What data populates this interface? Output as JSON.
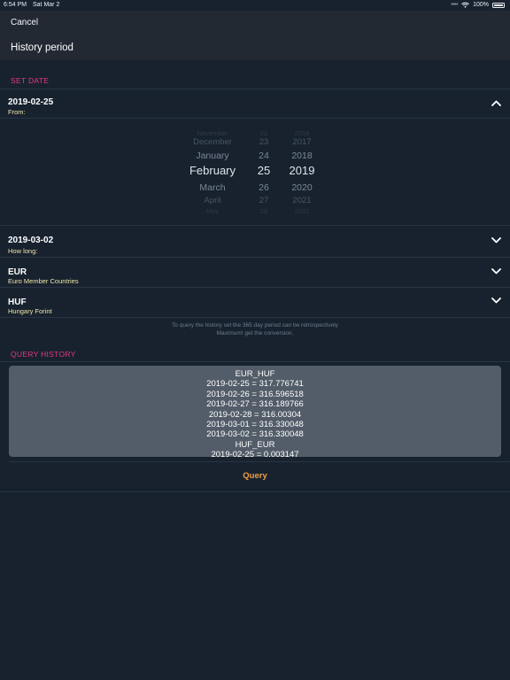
{
  "status_bar": {
    "time": "6:54 PM",
    "date": "Sat Mar 2",
    "battery": "100%"
  },
  "nav": {
    "cancel_label": "Cancel",
    "title": "History period"
  },
  "sections": {
    "set_date": "SET DATE",
    "query_history": "QUERY HISTORY"
  },
  "from_row": {
    "value": "2019-02-25",
    "label": "From:"
  },
  "date_picker": {
    "months": [
      "November",
      "December",
      "January",
      "February",
      "March",
      "April",
      "May"
    ],
    "days": [
      "22",
      "23",
      "24",
      "25",
      "26",
      "27",
      "28"
    ],
    "years": [
      "2016",
      "2017",
      "2018",
      "2019",
      "2020",
      "2021",
      "2022"
    ],
    "selected": {
      "month": "February",
      "day": "25",
      "year": "2019"
    }
  },
  "to_row": {
    "value": "2019-03-02",
    "label": "How long:"
  },
  "base_currency": {
    "code": "EUR",
    "name": "Euro Member Countries"
  },
  "target_currency": {
    "code": "HUF",
    "name": "Hungary Forint"
  },
  "footnote": {
    "line1": "To query the history set the 365 day period can be retrospectively",
    "line2": "Maximum! get the conversion."
  },
  "history": {
    "lines": [
      "EUR_HUF",
      "2019-02-25 = 317.776741",
      "2019-02-26 = 316.596518",
      "2019-02-27 = 316.189766",
      "2019-02-28 = 316.00304",
      "2019-03-01 = 316.330048",
      "2019-03-02 = 316.330048",
      "HUF_EUR",
      "2019-02-25 = 0.003147"
    ]
  },
  "query_button": {
    "label": "Query"
  },
  "colors": {
    "accent_pink": "#e8377a",
    "accent_orange": "#f0a040",
    "background": "#18222f"
  }
}
